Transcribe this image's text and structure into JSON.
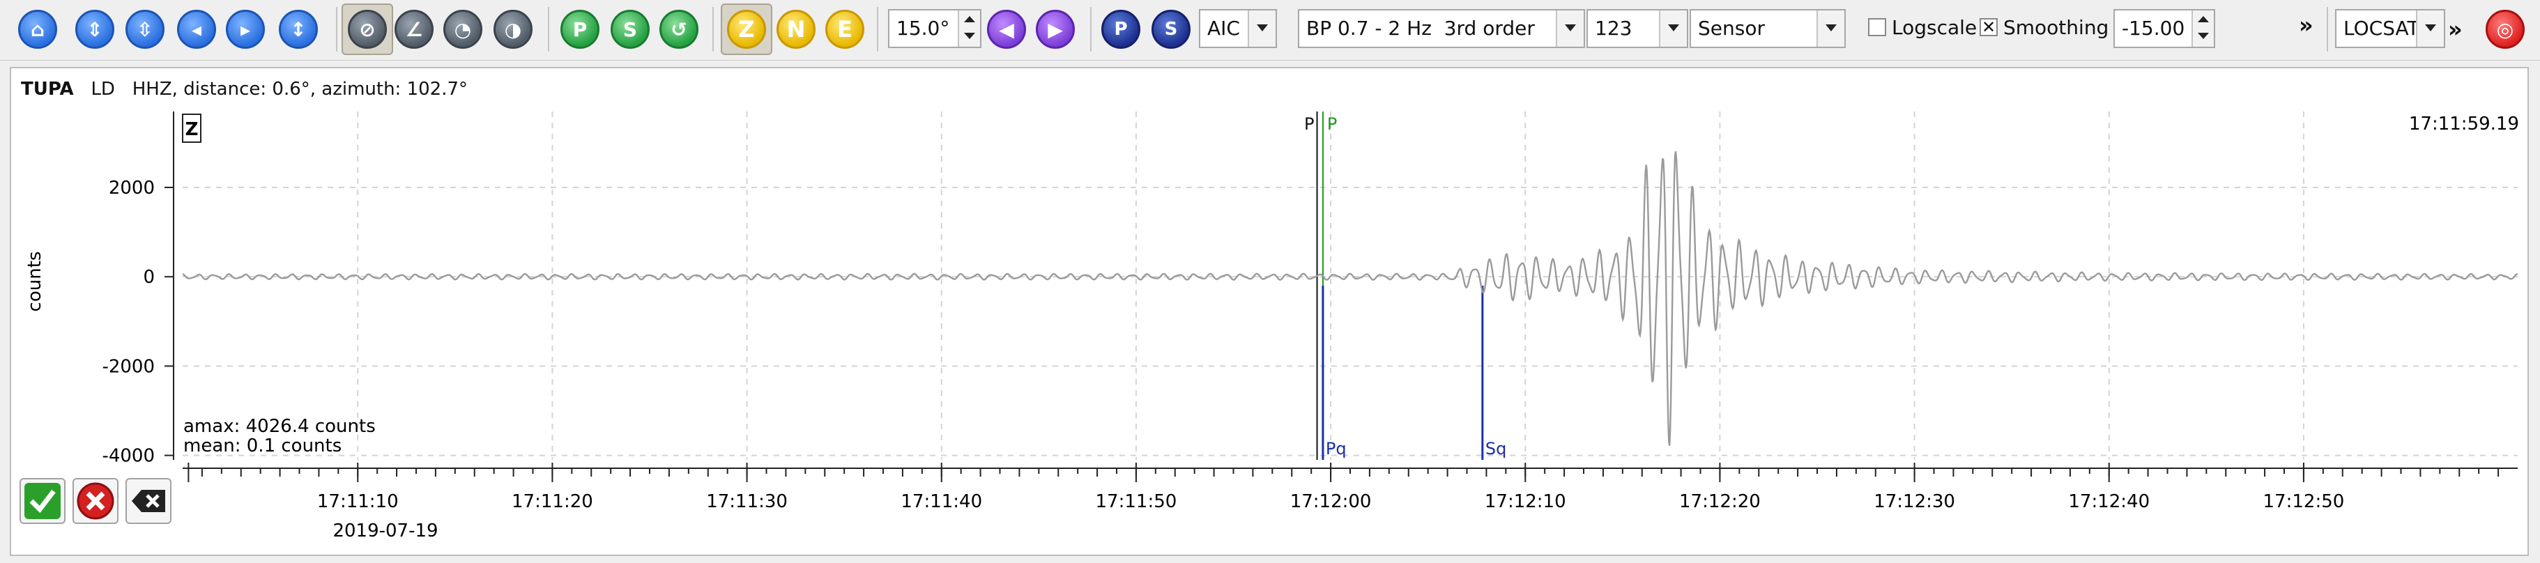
{
  "toolbar": {
    "filter_angle": "15.0°",
    "picker_method": "AIC",
    "filter": "BP 0.7 - 2 Hz  3rd order",
    "channel_set": "123",
    "unit_mode": "Sensor",
    "logscale": {
      "label": "Logscale",
      "checked": false
    },
    "smoothing": {
      "label": "Smoothing",
      "checked": true
    },
    "smoothing_value": "-15.00",
    "overflow_glyph": "»",
    "locator": "LOCSAT",
    "locator_overflow_glyph": "»",
    "component_buttons": [
      "Z",
      "N",
      "E"
    ],
    "phase_buttons": [
      "P",
      "S"
    ],
    "icons": [
      "home-icon",
      "zoom-in-icon",
      "zoom-out-icon",
      "shift-left-icon",
      "shift-right-icon",
      "fit-icon",
      "pick-mode-icon",
      "measure-angle-icon",
      "spectrum-icon",
      "rotate-icon",
      "pick-p-icon",
      "pick-s-icon",
      "pick-custom-icon",
      "accept-icon",
      "reject-icon",
      "delete-icon",
      "close-icon"
    ]
  },
  "trace": {
    "station": "TUPA",
    "network": "LD",
    "channel": "HHZ",
    "info": "distance: 0.6°, azimuth: 102.7°",
    "component_badge": "Z",
    "end_time": "17:11:59.19",
    "amax": "amax: 4026.4 counts",
    "mean": "mean: 0.1 counts",
    "date": "2019-07-19"
  },
  "colors": {
    "trace": "#9a9a9a",
    "pick_marker": "#1a2fa8",
    "p_green": "#1a9a1a",
    "grid": "#d4d4d4"
  },
  "chart_data": {
    "type": "line",
    "ylabel": "counts",
    "ylim": [
      -4100,
      3700
    ],
    "yticks": [
      2000,
      0,
      -2000,
      -4000
    ],
    "xlim_seconds": [
      1,
      61
    ],
    "xticks": [
      {
        "t": 10,
        "label": "17:11:10"
      },
      {
        "t": 20,
        "label": "17:11:20"
      },
      {
        "t": 30,
        "label": "17:11:30"
      },
      {
        "t": 40,
        "label": "17:11:40"
      },
      {
        "t": 50,
        "label": "17:11:50"
      },
      {
        "t": 60,
        "label": "17:12:00"
      },
      {
        "t": 70,
        "label": "17:12:10"
      },
      {
        "t": 80,
        "label": "17:12:20"
      },
      {
        "t": 90,
        "label": "17:12:30"
      },
      {
        "t": 100,
        "label": "17:12:40"
      },
      {
        "t": 110,
        "label": "17:12:50"
      }
    ],
    "picks": [
      {
        "t": 59.3,
        "label": "P",
        "kind": "current",
        "color": "#111111"
      },
      {
        "t": 59.6,
        "label": "P",
        "kind": "current",
        "color": "#1a9a1a"
      },
      {
        "t": 59.6,
        "label": "Pq",
        "kind": "theoretical",
        "color": "#1a2fa8"
      },
      {
        "t": 67.8,
        "label": "Sq",
        "kind": "theoretical",
        "color": "#1a2fa8"
      }
    ],
    "envelope": [
      {
        "t": 0,
        "a": 60
      },
      {
        "t": 66,
        "a": 70
      },
      {
        "t": 67.2,
        "a": 300
      },
      {
        "t": 69.5,
        "a": 600
      },
      {
        "t": 72,
        "a": 350
      },
      {
        "t": 74.5,
        "a": 700
      },
      {
        "t": 75.5,
        "a": 1200
      },
      {
        "t": 76.8,
        "a": 3600
      },
      {
        "t": 77.7,
        "a": 3900
      },
      {
        "t": 78.8,
        "a": 1600
      },
      {
        "t": 80.5,
        "a": 900
      },
      {
        "t": 84,
        "a": 400
      },
      {
        "t": 90,
        "a": 160
      },
      {
        "t": 100,
        "a": 90
      },
      {
        "t": 120,
        "a": 60
      }
    ]
  }
}
